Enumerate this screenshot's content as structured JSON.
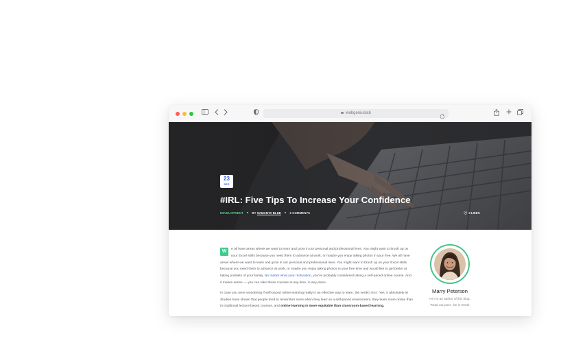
{
  "browser": {
    "url": "webgeniuslab"
  },
  "post": {
    "date_day": "23",
    "date_month": "SEP",
    "title": "#IRL: Five Tips To Increase Your Confidence",
    "category": "DEVELOPMENT",
    "by_label": "BY",
    "author": "SAMANTA BLUE",
    "comments": "2 COMMENTS",
    "likes": "0 LIKES"
  },
  "article": {
    "dropcap": "W",
    "p1_text": "e all have areas where we want to learn and grow in our personal and professional lives. You might want to brush up on your Excel skills because you need them to advance at work, or maybe you enjoy taking photos in your free. We all have areas where we want to learn and grow in our personal and professional lives. You might want to brush up on your Excel skills because you need them to advance at work, or maybe you enjoy taking photos in your free time and would like to get better at taking portraits of your family.",
    "p1_link": "No matter what your motivation,",
    "p1_tail": "you've probably considered taking a self-paced online course. And it makes sense — you can take these courses at any time, in any place.",
    "p2_text": "In case you were wondering if self-paced online learning really is an effective way to learn, the verdict is in. Yes, it absolutely is! Studies have shown that people tend to remember more when they learn in a self-paced environment, they learn more online than in traditional lecture-based courses, and",
    "p2_bold": "online learning is more equitable than classroom-based learning."
  },
  "author_card": {
    "name": "Marry Peterson",
    "bio_line1": "Hi! I'm an author of this blog.",
    "bio_line2": "Read our post - be in trend!"
  },
  "colors": {
    "accent_green": "#40c98d",
    "link_blue": "#3a64d6",
    "date_blue": "#2f5fd0"
  }
}
